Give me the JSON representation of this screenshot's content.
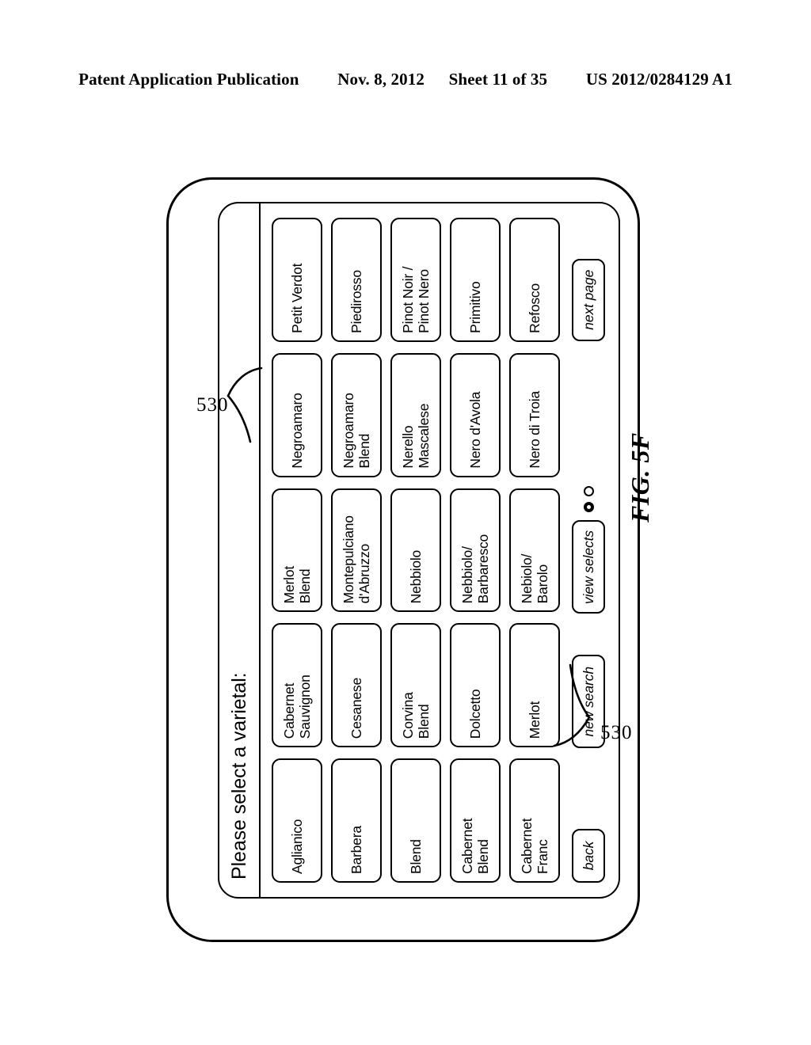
{
  "header": {
    "publication": "Patent Application Publication",
    "date": "Nov. 8, 2012",
    "sheet": "Sheet 11 of 35",
    "number": "US 2012/0284129 A1"
  },
  "figure": {
    "label": "FIG. 5F",
    "reference_numeral_top": "530",
    "reference_numeral_bottom": "530"
  },
  "screen": {
    "prompt": "Please select a varietal:",
    "columns": [
      {
        "index": 0,
        "items": [
          "Aglianico",
          "Barbera",
          "Blend",
          "Cabernet\nBlend",
          "Cabernet\nFranc"
        ],
        "action": {
          "label": "back",
          "name": "back-button"
        }
      },
      {
        "index": 1,
        "items": [
          "Cabernet\nSauvignon",
          "Cesanese",
          "Corvina\nBlend",
          "Dolcetto",
          "Merlot"
        ],
        "action": {
          "label": "new search",
          "name": "new-search-button"
        }
      },
      {
        "index": 2,
        "items": [
          "Merlot\nBlend",
          "Montepulciano\nd'Abruzzo",
          "Nebbiolo",
          "Nebbiolo/\nBarbaresco",
          "Nebiolo/\nBarolo"
        ],
        "action": {
          "label": "view selects",
          "name": "view-selects-button"
        }
      },
      {
        "index": 3,
        "items": [
          "Negroamaro",
          "Negroamaro\nBlend",
          "Nerello\nMascalese",
          "Nero d'Avola",
          "Nero di Troia"
        ],
        "action": null
      },
      {
        "index": 4,
        "items": [
          "Petit Verdot",
          "Piedirosso",
          "Pinot Noir /\nPinot Nero",
          "Primitivo",
          "Refosco"
        ],
        "action": {
          "label": "next page",
          "name": "next-page-button"
        }
      }
    ],
    "pagination_dots": 2
  },
  "colors": {
    "ink": "#000000",
    "paper": "#ffffff"
  }
}
